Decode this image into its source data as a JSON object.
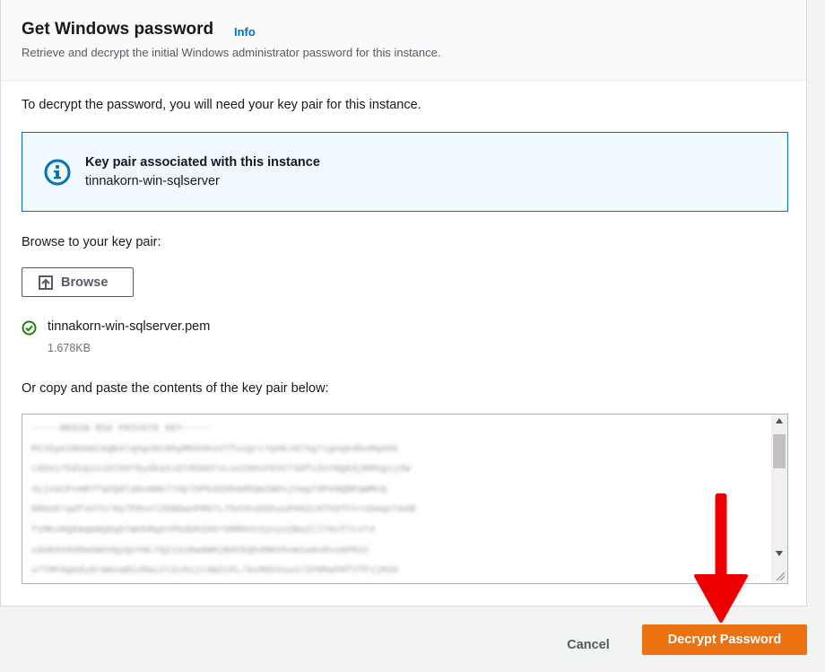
{
  "header": {
    "title": "Get Windows password",
    "info_link": "Info",
    "subtitle": "Retrieve and decrypt the initial Windows administrator password for this instance."
  },
  "intro_text": "To decrypt the password, you will need your key pair for this instance.",
  "alert": {
    "icon": "info-circle-icon",
    "title": "Key pair associated with this instance",
    "value": "tinnakorn-win-sqlserver",
    "accent_color": "#0073bb"
  },
  "browse": {
    "label": "Browse to your key pair:",
    "button_label": "Browse",
    "button_icon": "upload-icon"
  },
  "file": {
    "status_icon": "check-circle-icon",
    "status_color": "#1d8102",
    "name": "tinnakorn-win-sqlserver.pem",
    "size": "1.678KB"
  },
  "paste": {
    "label": "Or copy and paste the contents of the key pair below:",
    "lines": [
      "-----BEGIN RSA PRIVATE KEY-----",
      "MIIEpAIBAAKCAQEAlqHgnbc8hpMHXhKsVTfuxQrc7pHkJ87Xg7igUqkdbvMqXHk",
      "LHDX17bd1QJzxkC90TbydkaXJZtMZbEFxLuoZ8HsFKVCT3dfcZnYNgKdjRMVgxjZW",
      "4yjvaCPvmBTfqUQdlq8xmWe77AplhPkdZDKmd8qm2WDxjVwgTdPeNQBPqWMnQ",
      "8RHoE+qdfxU7n/8p7PRnnl2DNDwnPMH7L75eVkuDbhuuPH9ZcHThDTFn+nbAqcYAAR",
      "fzMKsMQRmqm8Q6qD7WebMqAYPbdD0Z6K+9MM0Vn3ynyvZBa3llT9cf7txT4",
      "xdUK6X9SMaKWUVQyQnYNLTQZ1XzRwdWMjBdCbQhdMKVhnWiwdvMvvGPMzC",
      "u7TMF0gGdydrWmvaBIzMaLCtZcDsjtdmZcPL/GxMGhVuu3/ZFRMaPRfIfPJjM3X"
    ]
  },
  "footer": {
    "cancel_label": "Cancel",
    "decrypt_label": "Decrypt Password",
    "primary_color": "#ec7211"
  },
  "annotation": {
    "icon": "red-arrow-down-icon",
    "color": "#ee0000"
  }
}
